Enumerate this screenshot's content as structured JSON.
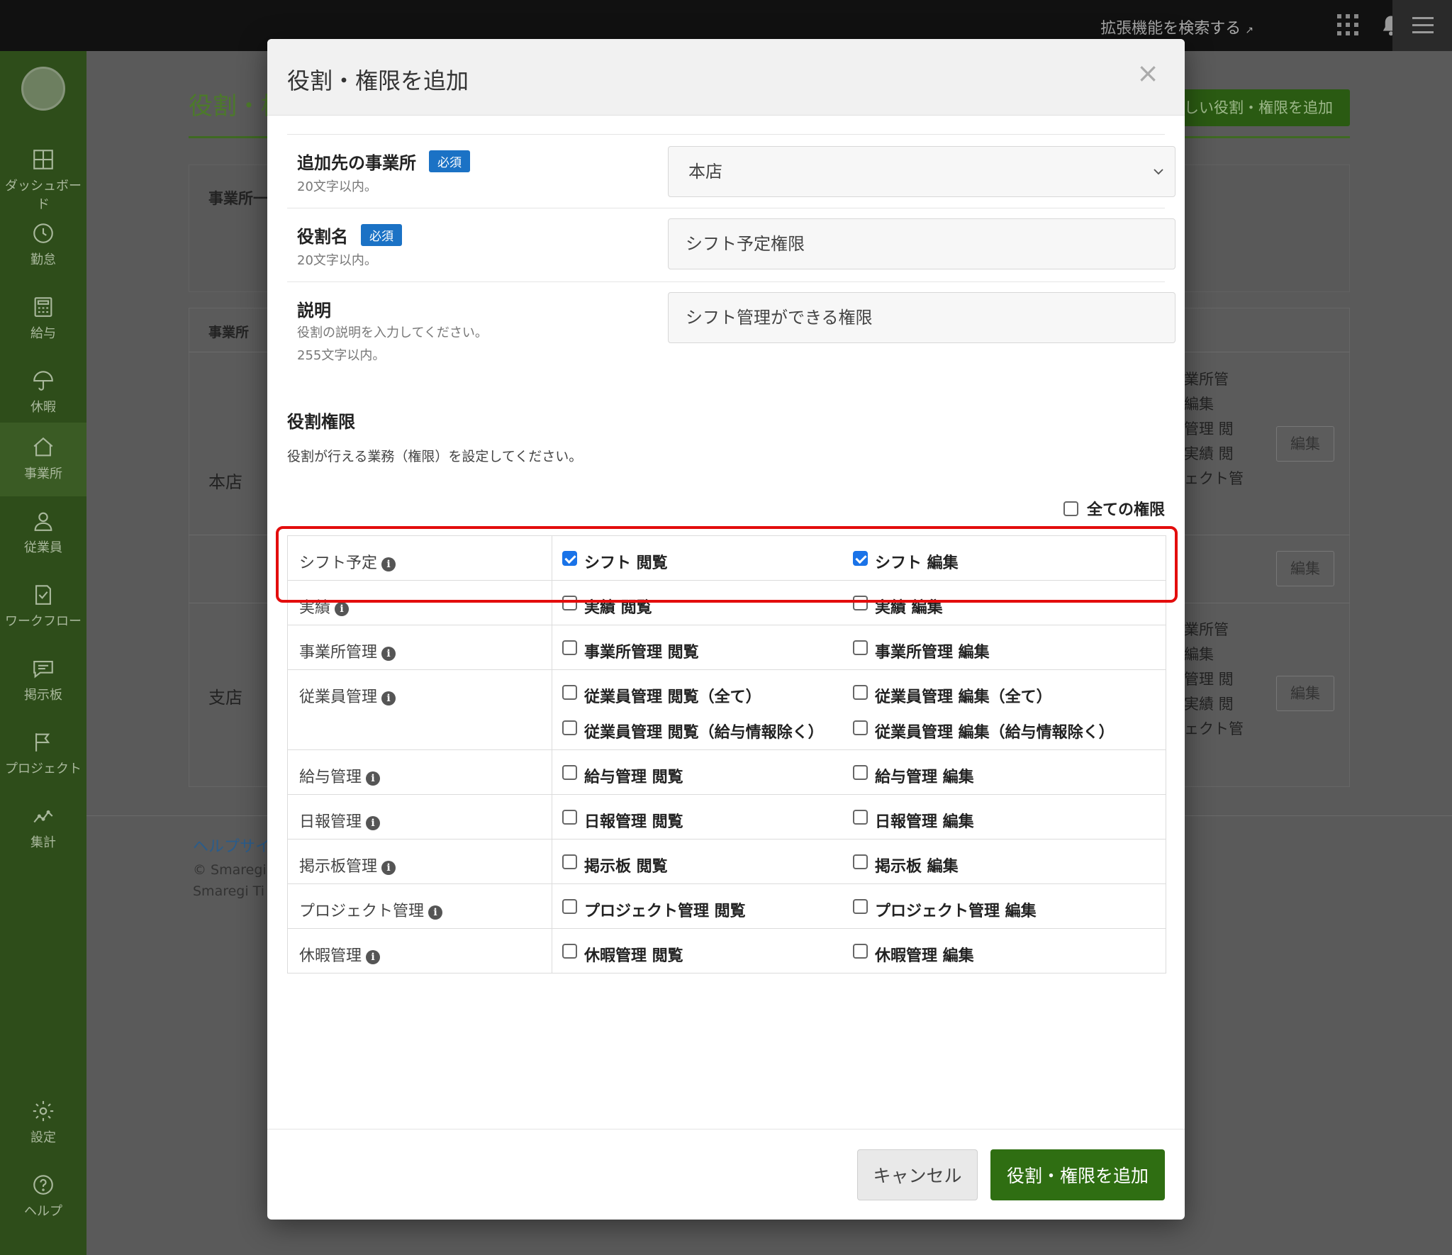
{
  "topbar": {
    "extension_search": "拡張機能を検索する",
    "external_icon": "external-link-icon",
    "apps_icon": "grid-icon",
    "notification_icon": "bell-icon",
    "menu_icon": "hamburger-icon"
  },
  "sidebar": {
    "items": [
      {
        "label": "ダッシュボード",
        "icon": "dashboard-icon"
      },
      {
        "label": "勤怠",
        "icon": "clock-icon"
      },
      {
        "label": "給与",
        "icon": "calculator-icon"
      },
      {
        "label": "休暇",
        "icon": "umbrella-icon"
      },
      {
        "label": "事業所",
        "icon": "home-icon"
      },
      {
        "label": "従業員",
        "icon": "user-icon"
      },
      {
        "label": "ワークフロー",
        "icon": "checklist-icon"
      },
      {
        "label": "掲示板",
        "icon": "chat-icon"
      },
      {
        "label": "プロジェクト",
        "icon": "flag-icon"
      },
      {
        "label": "集計",
        "icon": "chart-icon"
      }
    ],
    "bottom": [
      {
        "label": "設定",
        "icon": "gear-icon"
      },
      {
        "label": "ヘルプ",
        "icon": "help-icon"
      }
    ]
  },
  "background": {
    "page_title": "役割・権",
    "add_button": "しい役割・権限を追加",
    "panel_label": "事業所一",
    "table_header": "事業所",
    "stores": [
      "本店",
      "支店"
    ],
    "peek_lines_1": [
      "業所管",
      "編集",
      "管理 閲",
      "実績 閲",
      "ェクト管"
    ],
    "peek_lines_2": [
      "業所管",
      "編集",
      "管理 閲",
      "実績 閲",
      "ェクト管"
    ],
    "edit_label": "編集",
    "help_link": "ヘルプサイ",
    "copyright_1": "© Smaregi,",
    "copyright_2": "Smaregi Ti"
  },
  "modal": {
    "title": "役割・権限を追加",
    "close_symbol": "×",
    "required_label": "必須",
    "office": {
      "label": "追加先の事業所",
      "hint": "20文字以内。",
      "value": "本店"
    },
    "role_name": {
      "label": "役割名",
      "hint": "20文字以内。",
      "value": "シフト予定権限"
    },
    "description": {
      "label": "説明",
      "hint_1": "役割の説明を入力してください。",
      "hint_2": "255文字以内。",
      "value": "シフト管理ができる権限"
    },
    "permissions_title": "役割権限",
    "permissions_desc": "役割が行える業務（権限）を設定してください。",
    "all_permissions": "全ての権限",
    "rows": [
      {
        "category": "シフト予定",
        "options": [
          [
            {
              "label": "シフト 閲覧",
              "checked": true
            },
            {
              "label": "シフト 編集",
              "checked": true
            }
          ]
        ]
      },
      {
        "category": "実績",
        "options": [
          [
            {
              "label": "実績 閲覧",
              "checked": false
            },
            {
              "label": "実績 編集",
              "checked": false
            }
          ]
        ]
      },
      {
        "category": "事業所管理",
        "options": [
          [
            {
              "label": "事業所管理 閲覧",
              "checked": false
            },
            {
              "label": "事業所管理 編集",
              "checked": false
            }
          ]
        ]
      },
      {
        "category": "従業員管理",
        "options": [
          [
            {
              "label": "従業員管理 閲覧（全て）",
              "checked": false
            },
            {
              "label": "従業員管理 編集（全て）",
              "checked": false
            }
          ],
          [
            {
              "label": "従業員管理 閲覧（給与情報除く）",
              "checked": false
            },
            {
              "label": "従業員管理 編集（給与情報除く）",
              "checked": false
            }
          ]
        ]
      },
      {
        "category": "給与管理",
        "options": [
          [
            {
              "label": "給与管理 閲覧",
              "checked": false
            },
            {
              "label": "給与管理 編集",
              "checked": false
            }
          ]
        ]
      },
      {
        "category": "日報管理",
        "options": [
          [
            {
              "label": "日報管理 閲覧",
              "checked": false
            },
            {
              "label": "日報管理 編集",
              "checked": false
            }
          ]
        ]
      },
      {
        "category": "掲示板管理",
        "options": [
          [
            {
              "label": "掲示板 閲覧",
              "checked": false
            },
            {
              "label": "掲示板 編集",
              "checked": false
            }
          ]
        ]
      },
      {
        "category": "プロジェクト管理",
        "options": [
          [
            {
              "label": "プロジェクト管理 閲覧",
              "checked": false
            },
            {
              "label": "プロジェクト管理 編集",
              "checked": false
            }
          ]
        ]
      },
      {
        "category": "休暇管理",
        "options": [
          [
            {
              "label": "休暇管理 閲覧",
              "checked": false
            },
            {
              "label": "休暇管理 編集",
              "checked": false
            }
          ]
        ]
      }
    ],
    "cancel_label": "キャンセル",
    "submit_label": "役割・権限を追加",
    "colors": {
      "primary": "#2f6e12",
      "badge": "#1b72c5",
      "highlight": "#e30d0d"
    }
  }
}
